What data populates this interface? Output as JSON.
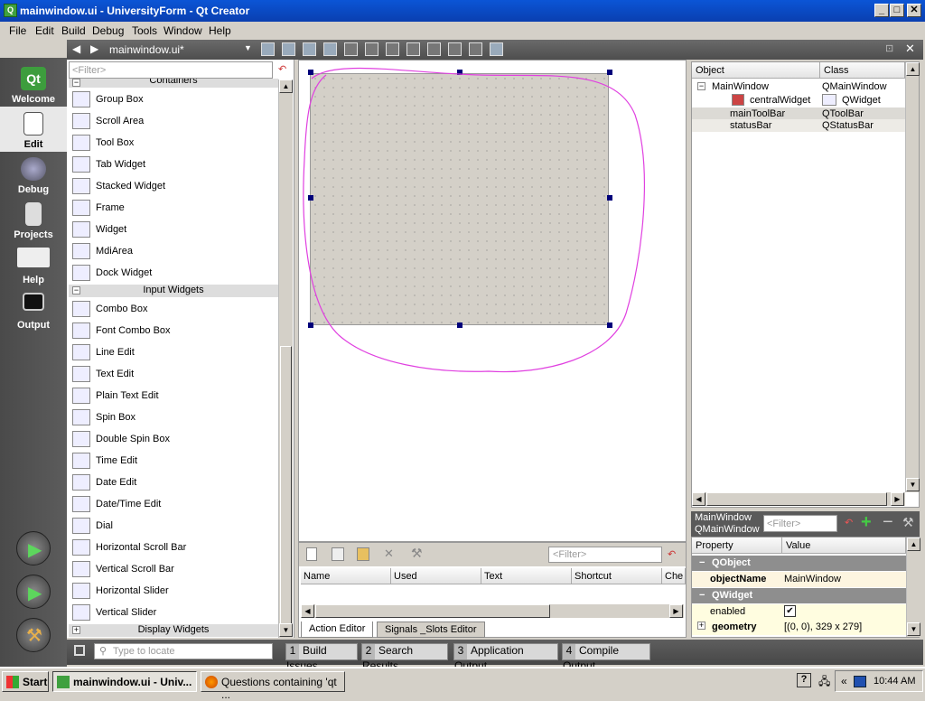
{
  "window": {
    "title": "mainwindow.ui - UniversityForm - Qt Creator",
    "app_icon": "qt-icon",
    "min": "_",
    "max": "□",
    "close": "✕"
  },
  "menu": [
    "File",
    "Edit",
    "Build",
    "Debug",
    "Tools",
    "Window",
    "Help"
  ],
  "modes": [
    {
      "label": "Welcome",
      "icon": "qt-logo-icon"
    },
    {
      "label": "Edit",
      "icon": "document-icon"
    },
    {
      "label": "Debug",
      "icon": "bug-icon"
    },
    {
      "label": "Projects",
      "icon": "folder-icon"
    },
    {
      "label": "Help",
      "icon": "book-icon"
    },
    {
      "label": "Output",
      "icon": "monitor-icon"
    }
  ],
  "toolbar": {
    "file_name": "mainwindow.ui*",
    "back": "◀",
    "forward": "▶",
    "close": "✕"
  },
  "widget_box": {
    "filter_placeholder": "<Filter>",
    "containers_label": "Containers",
    "containers": [
      "Group Box",
      "Scroll Area",
      "Tool Box",
      "Tab Widget",
      "Stacked Widget",
      "Frame",
      "Widget",
      "MdiArea",
      "Dock Widget"
    ],
    "input_label": "Input Widgets",
    "inputs": [
      "Combo Box",
      "Font Combo Box",
      "Line Edit",
      "Text Edit",
      "Plain Text Edit",
      "Spin Box",
      "Double Spin Box",
      "Time Edit",
      "Date Edit",
      "Date/Time Edit",
      "Dial",
      "Horizontal Scroll Bar",
      "Vertical Scroll Bar",
      "Horizontal Slider",
      "Vertical Slider"
    ],
    "display_label": "Display Widgets",
    "expand_glyph": "+",
    "collapse_glyph": "−"
  },
  "action_editor": {
    "filter_placeholder": "<Filter>",
    "columns": [
      "Name",
      "Used",
      "Text",
      "Shortcut",
      "Che"
    ],
    "tabs": [
      "Action Editor",
      "Signals _Slots Editor"
    ]
  },
  "object_inspector": {
    "columns": [
      "Object",
      "Class"
    ],
    "rows": [
      {
        "object": "MainWindow",
        "class": "QMainWindow"
      },
      {
        "object": "centralWidget",
        "class": "QWidget"
      },
      {
        "object": "mainToolBar",
        "class": "QToolBar"
      },
      {
        "object": "statusBar",
        "class": "QStatusBar"
      }
    ]
  },
  "property_editor": {
    "object_name": "MainWindow",
    "class_name": "QMainWindow",
    "filter_placeholder": "<Filter>",
    "columns": [
      "Property",
      "Value"
    ],
    "rows": [
      {
        "type": "group",
        "name": "QObject"
      },
      {
        "type": "prop",
        "name": "objectName",
        "value": "MainWindow"
      },
      {
        "type": "group",
        "name": "QWidget"
      },
      {
        "type": "prop",
        "name": "enabled",
        "value": "✔"
      },
      {
        "type": "prop",
        "name": "geometry",
        "value": "[(0, 0), 329 x 279]"
      }
    ]
  },
  "output_bar": {
    "locate_placeholder": "Type to locate",
    "buttons": [
      {
        "num": "1",
        "label": "Build Issues"
      },
      {
        "num": "2",
        "label": "Search Results"
      },
      {
        "num": "3",
        "label": "Application Output"
      },
      {
        "num": "4",
        "label": "Compile Output"
      }
    ]
  },
  "taskbar": {
    "start": "Start",
    "tasks": [
      "mainwindow.ui - Univ...",
      "Questions containing 'qt ..."
    ],
    "clock": "10:44 AM",
    "help_glyph": "?",
    "tray_arrows": "«"
  },
  "colors": {
    "titlebar": "#0a47c4",
    "modebar": "#505050",
    "annotation": "#e040e0",
    "handle": "#00007a"
  }
}
